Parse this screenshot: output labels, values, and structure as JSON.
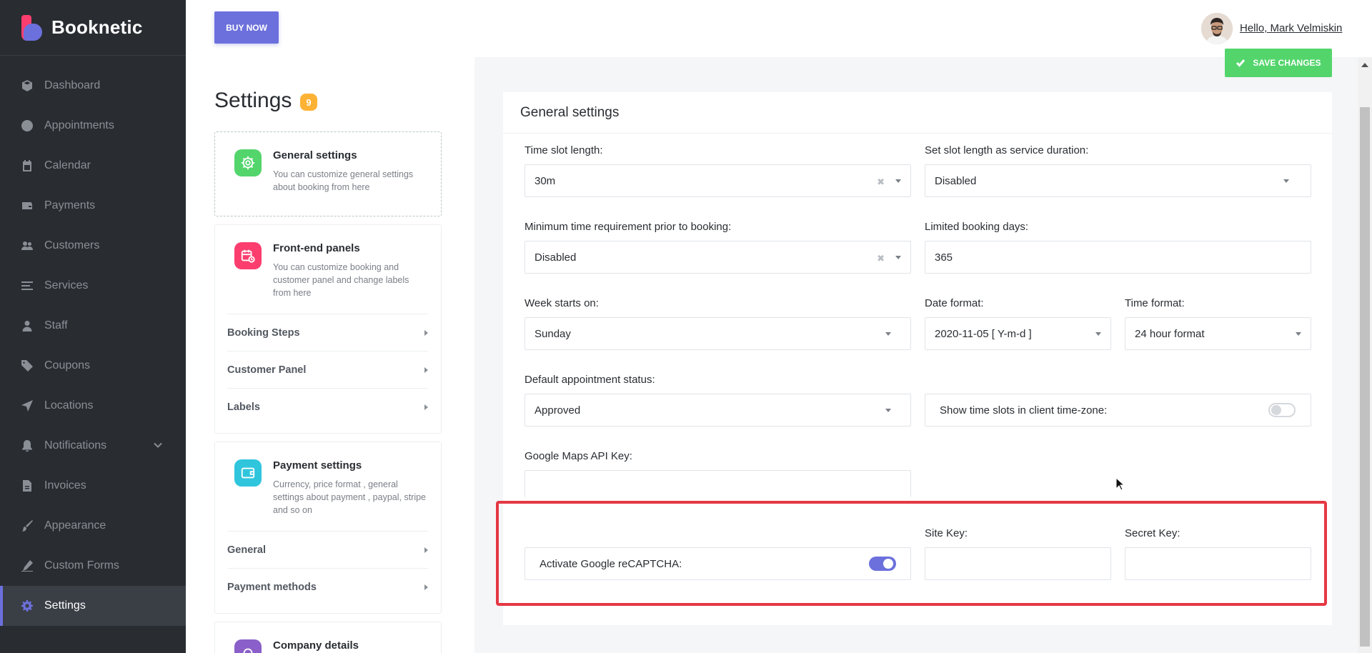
{
  "brand": {
    "name": "Booknetic"
  },
  "sidebar": {
    "items": [
      {
        "label": "Dashboard",
        "icon": "cube-icon"
      },
      {
        "label": "Appointments",
        "icon": "clock-icon"
      },
      {
        "label": "Calendar",
        "icon": "calendar-icon"
      },
      {
        "label": "Payments",
        "icon": "wallet-icon"
      },
      {
        "label": "Customers",
        "icon": "users-icon"
      },
      {
        "label": "Services",
        "icon": "list-icon"
      },
      {
        "label": "Staff",
        "icon": "user-icon"
      },
      {
        "label": "Coupons",
        "icon": "tag-icon"
      },
      {
        "label": "Locations",
        "icon": "location-arrow-icon"
      },
      {
        "label": "Notifications",
        "icon": "bell-icon"
      },
      {
        "label": "Invoices",
        "icon": "file-icon"
      },
      {
        "label": "Appearance",
        "icon": "brush-icon"
      },
      {
        "label": "Custom Forms",
        "icon": "pen-icon"
      },
      {
        "label": "Settings",
        "icon": "gear-icon"
      }
    ],
    "active": "Settings"
  },
  "topbar": {
    "buy_label": "BUY NOW",
    "greeting": "Hello, Mark Velmiskin"
  },
  "settings_menu": {
    "title": "Settings",
    "badge": "9",
    "cards": [
      {
        "title": "General settings",
        "desc": "You can customize general settings about booking from here",
        "color": "#53d56c",
        "icon": "gear-icon"
      },
      {
        "title": "Front-end panels",
        "desc": "You can customize booking and customer panel and change labels from here",
        "color": "#fb3e6e",
        "icon": "calendar-clock-icon",
        "items": [
          "Booking Steps",
          "Customer Panel",
          "Labels"
        ]
      },
      {
        "title": "Payment settings",
        "desc": "Currency, price format , general settings about payment , paypal, stripe and so on",
        "color": "#2fc5dd",
        "icon": "wallet-icon",
        "items": [
          "General",
          "Payment methods"
        ]
      },
      {
        "title": "Company details",
        "color": "#8b5fc9",
        "icon": "company-icon"
      }
    ]
  },
  "main": {
    "save_label": "SAVE CHANGES",
    "panel_title": "General settings",
    "fields": {
      "time_slot_length": {
        "label": "Time slot length:",
        "value": "30m"
      },
      "slot_as_service": {
        "label": "Set slot length as service duration:",
        "value": "Disabled"
      },
      "min_time": {
        "label": "Minimum time requirement prior to booking:",
        "value": "Disabled"
      },
      "limited_days": {
        "label": "Limited booking days:",
        "value": "365"
      },
      "week_start": {
        "label": "Week starts on:",
        "value": "Sunday"
      },
      "date_format": {
        "label": "Date format:",
        "value": "2020-11-05 [ Y-m-d ]"
      },
      "time_format": {
        "label": "Time format:",
        "value": "24 hour format"
      },
      "default_status": {
        "label": "Default appointment status:",
        "value": "Approved"
      },
      "client_tz": {
        "label": "Show time slots in client time-zone:",
        "enabled": false
      },
      "maps_key": {
        "label": "Google Maps API Key:",
        "value": ""
      },
      "recaptcha": {
        "label": "Activate Google reCAPTCHA:",
        "enabled": true
      },
      "site_key": {
        "label": "Site Key:",
        "value": ""
      },
      "secret_key": {
        "label": "Secret Key:",
        "value": ""
      }
    }
  }
}
